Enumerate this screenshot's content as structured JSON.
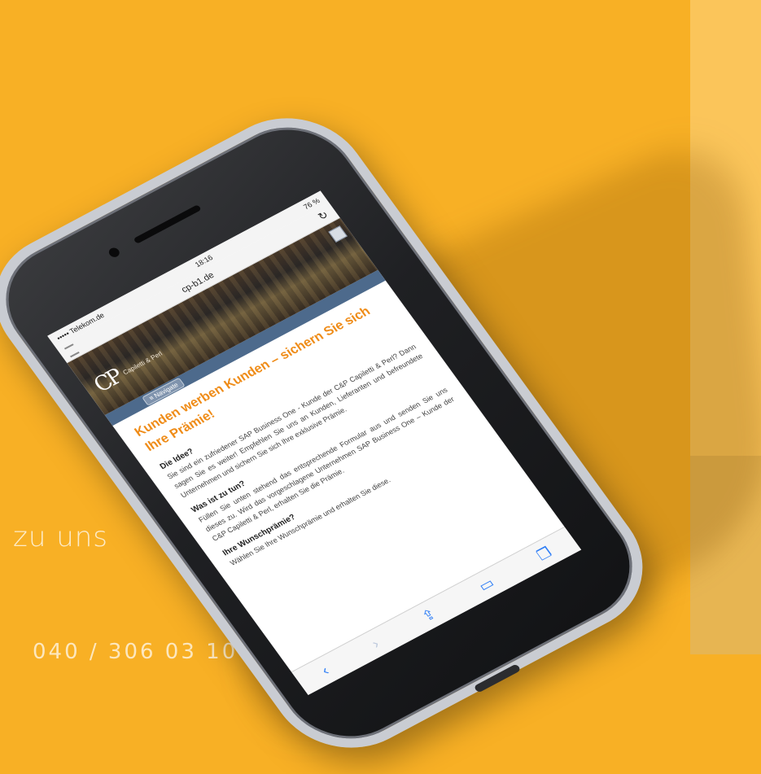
{
  "side_text": "zu uns",
  "phone_number": "040 / 306 03 100",
  "phone": {
    "status": {
      "carrier": "••••• Telekom.de",
      "time": "18:16",
      "battery": "76 %"
    },
    "url": "cp-b1.de",
    "logo_mark": "CP",
    "logo_sub": "Capiletti & Perl",
    "nav_label": "≡ Navigate",
    "headline": "Kunden werben Kunden – sichern Sie sich Ihre Prämie!",
    "sections": [
      {
        "heading": "Die Idee?",
        "text": "Sie sind ein zufriedener SAP Business One - Kunde der C&P Capiletti & Perl? Dann sagen Sie es weiter! Empfehlen Sie uns an Kunden, Lieferanten und befreundete Unternehmen und sichern Sie sich Ihre exklusive Prämie."
      },
      {
        "heading": "Was ist zu tun?",
        "text": "Füllen Sie unten stehend das entsprechende Formular aus und senden Sie uns dieses zu. Wird das vorgeschlagene Unternehmen SAP Business One – Kunde der C&P Capiletti & Perl, erhalten Sie die Prämie."
      },
      {
        "heading": "Ihre Wunschprämie?",
        "text": "Wählen Sie Ihre Wunschprämie und erhalten Sie diese."
      }
    ],
    "toolbar_icons": [
      "back-icon",
      "forward-icon",
      "share-icon",
      "bookmarks-icon",
      "tabs-icon"
    ]
  },
  "colors": {
    "background": "#f8b025",
    "panel": "#fbc55a",
    "headline": "#ef8c18",
    "link": "#2f7ef6"
  }
}
